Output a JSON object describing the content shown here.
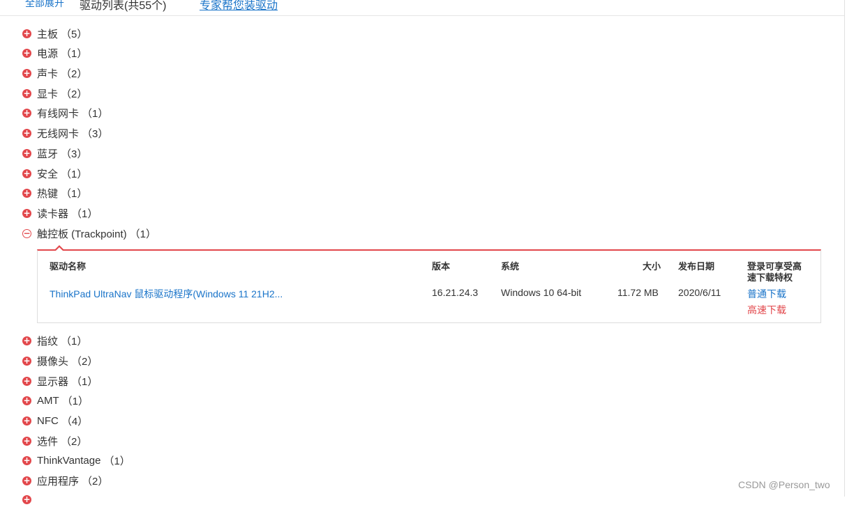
{
  "topbar": {
    "expand_all": "全部展开",
    "list_title": "驱动列表(共55个)",
    "expert_link": "专家帮您装驱动"
  },
  "categories_before": [
    {
      "name": "主板",
      "count": "（5）"
    },
    {
      "name": "电源",
      "count": "（1）"
    },
    {
      "name": "声卡",
      "count": "（2）"
    },
    {
      "name": "显卡",
      "count": "（2）"
    },
    {
      "name": "有线网卡",
      "count": "（1）"
    },
    {
      "name": "无线网卡",
      "count": "（3）"
    },
    {
      "name": "蓝牙",
      "count": "（3）"
    },
    {
      "name": "安全",
      "count": "（1）"
    },
    {
      "name": "热键",
      "count": "（1）"
    },
    {
      "name": "读卡器",
      "count": "（1）"
    }
  ],
  "expanded_category": {
    "name": "触控板 (Trackpoint)",
    "count": "（1）"
  },
  "table": {
    "headers": {
      "name": "驱动名称",
      "version": "版本",
      "system": "系统",
      "size": "大小",
      "date": "发布日期",
      "vip_line1": "登录可享受高",
      "vip_line2": "速下载特权"
    },
    "row": {
      "name": "ThinkPad UltraNav 鼠标驱动程序(Windows 11 21H2...",
      "version": "16.21.24.3",
      "system": "Windows 10 64-bit",
      "size": "11.72 MB",
      "date": "2020/6/11",
      "normal_download": "普通下载",
      "fast_download": "高速下载"
    }
  },
  "categories_after": [
    {
      "name": "指纹",
      "count": "（1）"
    },
    {
      "name": "摄像头",
      "count": "（2）"
    },
    {
      "name": "显示器",
      "count": "（1）"
    },
    {
      "name": "AMT",
      "count": "（1）"
    },
    {
      "name": "NFC",
      "count": "（4）"
    },
    {
      "name": "选件",
      "count": "（2）"
    },
    {
      "name": "ThinkVantage",
      "count": "（1）"
    },
    {
      "name": "应用程序",
      "count": "（2）"
    }
  ],
  "icons": {
    "expand": "plus-circle-icon",
    "collapse": "minus-circle-icon"
  },
  "colors": {
    "accent_red": "#e2474b",
    "link_blue": "#1a74c9"
  },
  "watermark": "CSDN @Person_two"
}
